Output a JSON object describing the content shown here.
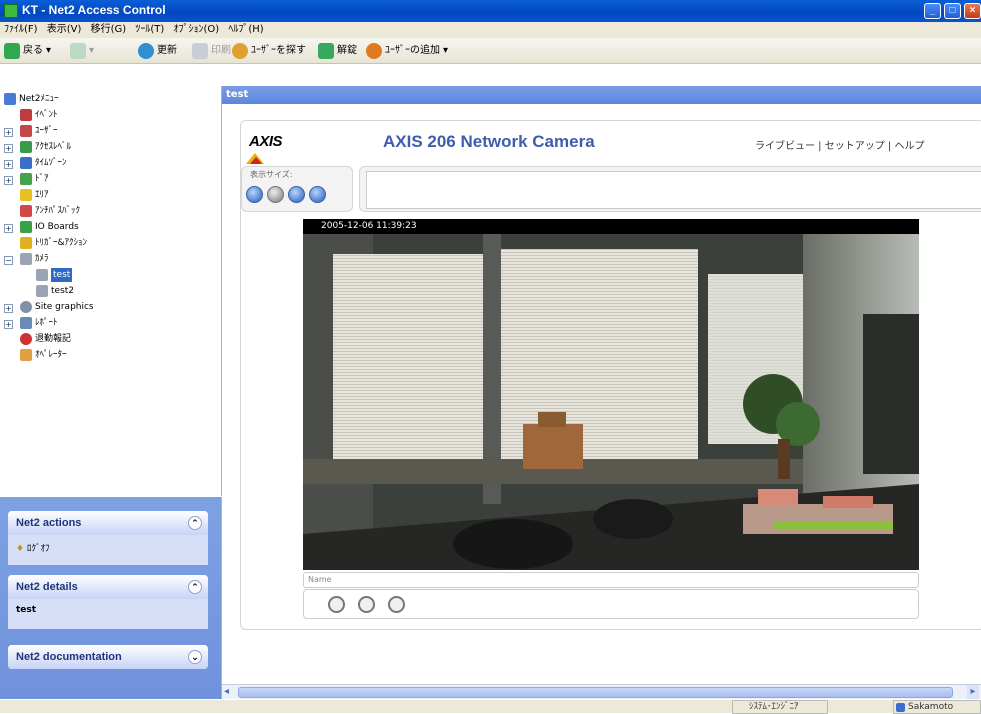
{
  "window": {
    "title": "KT - Net2 Access Control"
  },
  "menu": [
    "ﾌｧｲﾙ(F)",
    "表示(V)",
    "移行(G)",
    "ﾂｰﾙ(T)",
    "ｵﾌﾟｼｮﾝ(O)",
    "ﾍﾙﾌﾟ(H)"
  ],
  "toolbar": {
    "back": "戻る",
    "refresh": "更新",
    "print": "印刷",
    "find_user": "ﾕｰｻﾞｰを探す",
    "unlock": "解錠",
    "add_user": "ﾕｰｻﾞｰの追加"
  },
  "tree": {
    "root": "Net2ﾒﾆｭｰ",
    "items": [
      "ｲﾍﾞﾝﾄ",
      "ﾕｰｻﾞｰ",
      "ｱｸｾｽﾚﾍﾞﾙ",
      "ﾀｲﾑｿﾞｰﾝ",
      "ﾄﾞｱ",
      "ｴﾘｱ",
      "ｱﾝﾁﾊﾟｽﾊﾞｯｸ",
      "IO Boards",
      "ﾄﾘｶﾞｰ&ｱｸｼｮﾝ",
      "ｶﾒﾗ",
      "test",
      "test2",
      "Site graphics",
      "ﾚﾎﾟｰﾄ",
      "退勤報記",
      "ｵﾍﾟﾚｰﾀｰ"
    ]
  },
  "panels": {
    "actions": {
      "title": "Net2 actions",
      "item": "ﾛｸﾞｵﾌ"
    },
    "details": {
      "title": "Net2 details",
      "item": "test"
    },
    "documentation": {
      "title": "Net2 documentation"
    }
  },
  "content": {
    "header": "test",
    "axis_logo": "AXIS",
    "camera_title": "AXIS 206 Network Camera",
    "links": "ライブビュー | セットアップ | ヘルプ",
    "size_label": "表示サイズ:",
    "timestamp": "2005-12-06 11:39:23",
    "name_placeholder": "Name"
  },
  "status": {
    "role": "ｼｽﾃﾑ･ｴﾝｼﾞﾆｱ",
    "user": "Sakamoto"
  },
  "colors": {
    "title_blue": "#0347c2",
    "panel_blue": "#7da2e3",
    "axis_title": "#3e5dae"
  }
}
